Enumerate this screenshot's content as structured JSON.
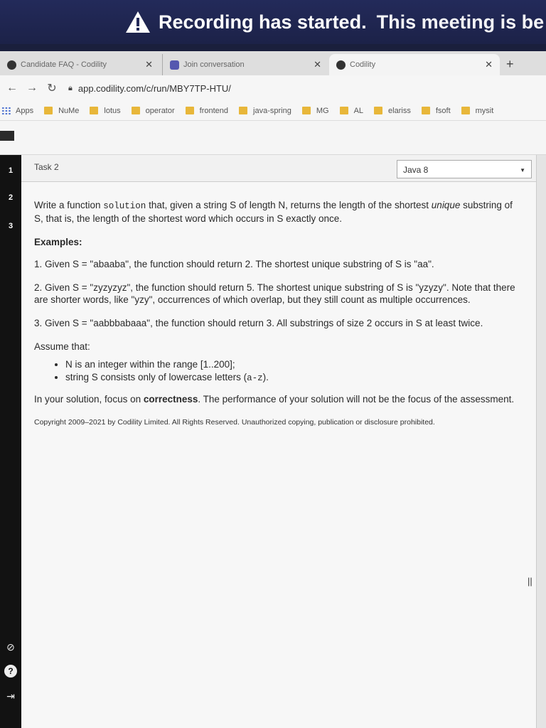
{
  "banner": {
    "title": "Recording has started.",
    "message": "This meeting is be"
  },
  "browser": {
    "tabs": [
      {
        "label": "Candidate FAQ - Codility",
        "icon": "codility-icon"
      },
      {
        "label": "Join conversation",
        "icon": "teams-icon"
      },
      {
        "label": "Codility",
        "icon": "codility-icon"
      }
    ],
    "url": "app.codility.com/c/run/MBY7TP-HTU/",
    "bookmarks": [
      "Apps",
      "NuMe",
      "lotus",
      "operator",
      "frontend",
      "java-spring",
      "MG",
      "AL",
      "elariss",
      "fsoft",
      "mysit"
    ]
  },
  "sidebar": {
    "tasks": [
      "1",
      "2",
      "3"
    ]
  },
  "task": {
    "title": "Task 2",
    "language": "Java 8"
  },
  "description": {
    "intro_1": "Write a function ",
    "fn_name": "solution",
    "intro_2": " that, given a string S of length N, returns the length of the shortest ",
    "intro_em": "unique",
    "intro_3": " substring of S, that is, the length of the shortest word which occurs in S exactly once.",
    "examples_heading": "Examples:",
    "examples": [
      "1. Given S = \"abaaba\", the function should return 2. The shortest unique substring of S is \"aa\".",
      "2. Given S = \"zyzyzyz\", the function should return 5. The shortest unique substring of S is \"yzyzy\". Note that there are shorter words, like \"yzy\", occurrences of which overlap, but they still count as multiple occurrences.",
      "3. Given S = \"aabbbabaaa\", the function should return 3. All substrings of size 2 occurs in S at least twice."
    ],
    "assume_heading": "Assume that:",
    "assumptions": {
      "a1": "N is an integer within the range [1..200];",
      "a2_pre": "string S consists only of lowercase letters (",
      "a2_code": "a-z",
      "a2_post": ")."
    },
    "focus_1": "In your solution, focus on ",
    "focus_bold": "correctness",
    "focus_2": ". The performance of your solution will not be the focus of the assessment.",
    "copyright": "Copyright 2009–2021 by Codility Limited. All Rights Reserved. Unauthorized copying, publication or disclosure prohibited."
  }
}
